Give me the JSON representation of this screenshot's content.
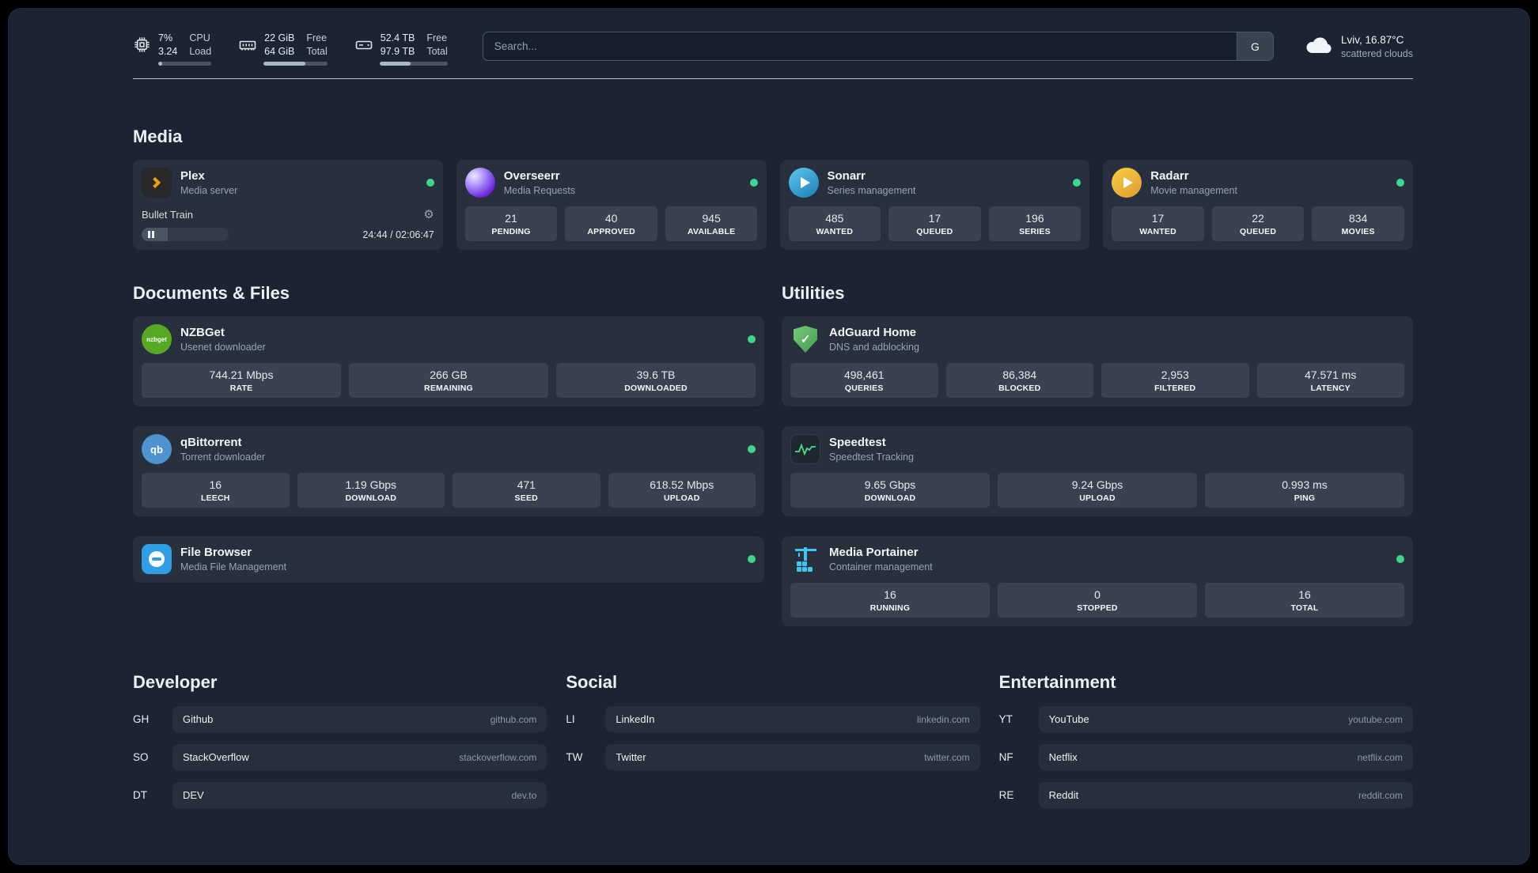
{
  "topbar": {
    "resources": [
      {
        "values": [
          "7%",
          "3.24"
        ],
        "labels": [
          "CPU",
          "Load"
        ],
        "used_percent": 7
      },
      {
        "values": [
          "22 GiB",
          "64 GiB"
        ],
        "labels": [
          "Free",
          "Total"
        ],
        "used_percent": 66
      },
      {
        "values": [
          "52.4 TB",
          "97.9 TB"
        ],
        "labels": [
          "Free",
          "Total"
        ],
        "used_percent": 46
      }
    ],
    "search": {
      "placeholder": "Search...",
      "provider_button": "G"
    },
    "weather": {
      "location": "Lviv, 16.87°C",
      "condition": "scattered clouds"
    }
  },
  "sections": {
    "media": {
      "title": "Media",
      "cards": [
        {
          "name": "Plex",
          "desc": "Media server",
          "online": true,
          "player": {
            "title": "Bullet Train",
            "time": "24:44 / 02:06:47",
            "progress_percent": 30
          }
        },
        {
          "name": "Overseerr",
          "desc": "Media Requests",
          "online": true,
          "stats": [
            {
              "value": "21",
              "label": "PENDING"
            },
            {
              "value": "40",
              "label": "APPROVED"
            },
            {
              "value": "945",
              "label": "AVAILABLE"
            }
          ]
        },
        {
          "name": "Sonarr",
          "desc": "Series management",
          "online": true,
          "stats": [
            {
              "value": "485",
              "label": "WANTED"
            },
            {
              "value": "17",
              "label": "QUEUED"
            },
            {
              "value": "196",
              "label": "SERIES"
            }
          ]
        },
        {
          "name": "Radarr",
          "desc": "Movie management",
          "online": true,
          "stats": [
            {
              "value": "17",
              "label": "WANTED"
            },
            {
              "value": "22",
              "label": "QUEUED"
            },
            {
              "value": "834",
              "label": "MOVIES"
            }
          ]
        }
      ]
    },
    "documents": {
      "title": "Documents & Files",
      "cards": [
        {
          "name": "NZBGet",
          "desc": "Usenet downloader",
          "online": true,
          "stats": [
            {
              "value": "744.21 Mbps",
              "label": "RATE"
            },
            {
              "value": "266 GB",
              "label": "REMAINING"
            },
            {
              "value": "39.6 TB",
              "label": "DOWNLOADED"
            }
          ]
        },
        {
          "name": "qBittorrent",
          "desc": "Torrent downloader",
          "online": true,
          "stats": [
            {
              "value": "16",
              "label": "LEECH"
            },
            {
              "value": "1.19 Gbps",
              "label": "DOWNLOAD"
            },
            {
              "value": "471",
              "label": "SEED"
            },
            {
              "value": "618.52 Mbps",
              "label": "UPLOAD"
            }
          ]
        },
        {
          "name": "File Browser",
          "desc": "Media File Management",
          "online": true,
          "stats": []
        }
      ]
    },
    "utilities": {
      "title": "Utilities",
      "cards": [
        {
          "name": "AdGuard Home",
          "desc": "DNS and adblocking",
          "online": false,
          "stats": [
            {
              "value": "498,461",
              "label": "QUERIES"
            },
            {
              "value": "86,384",
              "label": "BLOCKED"
            },
            {
              "value": "2,953",
              "label": "FILTERED"
            },
            {
              "value": "47.571 ms",
              "label": "LATENCY"
            }
          ]
        },
        {
          "name": "Speedtest",
          "desc": "Speedtest Tracking",
          "online": false,
          "stats": [
            {
              "value": "9.65 Gbps",
              "label": "DOWNLOAD"
            },
            {
              "value": "9.24 Gbps",
              "label": "UPLOAD"
            },
            {
              "value": "0.993 ms",
              "label": "PING"
            }
          ]
        },
        {
          "name": "Media Portainer",
          "desc": "Container management",
          "online": true,
          "stats": [
            {
              "value": "16",
              "label": "RUNNING"
            },
            {
              "value": "0",
              "label": "STOPPED"
            },
            {
              "value": "16",
              "label": "TOTAL"
            }
          ]
        }
      ]
    }
  },
  "bookmarks": [
    {
      "title": "Developer",
      "items": [
        {
          "abbr": "GH",
          "name": "Github",
          "url": "github.com"
        },
        {
          "abbr": "SO",
          "name": "StackOverflow",
          "url": "stackoverflow.com"
        },
        {
          "abbr": "DT",
          "name": "DEV",
          "url": "dev.to"
        }
      ]
    },
    {
      "title": "Social",
      "items": [
        {
          "abbr": "LI",
          "name": "LinkedIn",
          "url": "linkedin.com"
        },
        {
          "abbr": "TW",
          "name": "Twitter",
          "url": "twitter.com"
        }
      ]
    },
    {
      "title": "Entertainment",
      "items": [
        {
          "abbr": "YT",
          "name": "YouTube",
          "url": "youtube.com"
        },
        {
          "abbr": "NF",
          "name": "Netflix",
          "url": "netflix.com"
        },
        {
          "abbr": "RE",
          "name": "Reddit",
          "url": "reddit.com"
        }
      ]
    }
  ],
  "icon_labels": {
    "nzbget": "nzbget",
    "qbittorrent": "qb",
    "adguard_check": "✓"
  },
  "colors": {
    "panel_background": "#1c2433",
    "card_background": "#28303e",
    "stat_tile_background": "#3a4251",
    "online_dot": "#3ed68f",
    "plex_accent": "#e5a00d",
    "adguard_green": "#4f9e55",
    "portainer_blue": "#3ec6f0"
  }
}
